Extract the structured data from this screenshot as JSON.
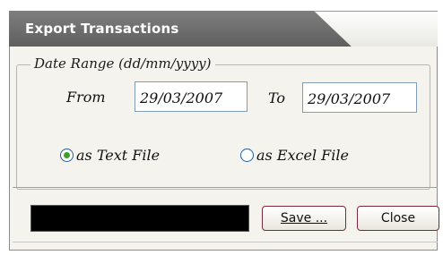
{
  "window": {
    "title": "Export Transactions"
  },
  "date_range": {
    "legend": "Date Range (dd/mm/yyyy)",
    "from_label": "From",
    "from_value": "29/03/2007",
    "to_label": "To",
    "to_value": "29/03/2007"
  },
  "format_options": [
    {
      "label": "as Text File",
      "selected": true
    },
    {
      "label": "as Excel File",
      "selected": false
    }
  ],
  "buttons": {
    "save_label": "Save ...",
    "close_label": "Close"
  },
  "colors": {
    "radio_selected": "#3aa02a",
    "title_bg": "#6e6e6e",
    "button_border": "#7a2a3a"
  }
}
